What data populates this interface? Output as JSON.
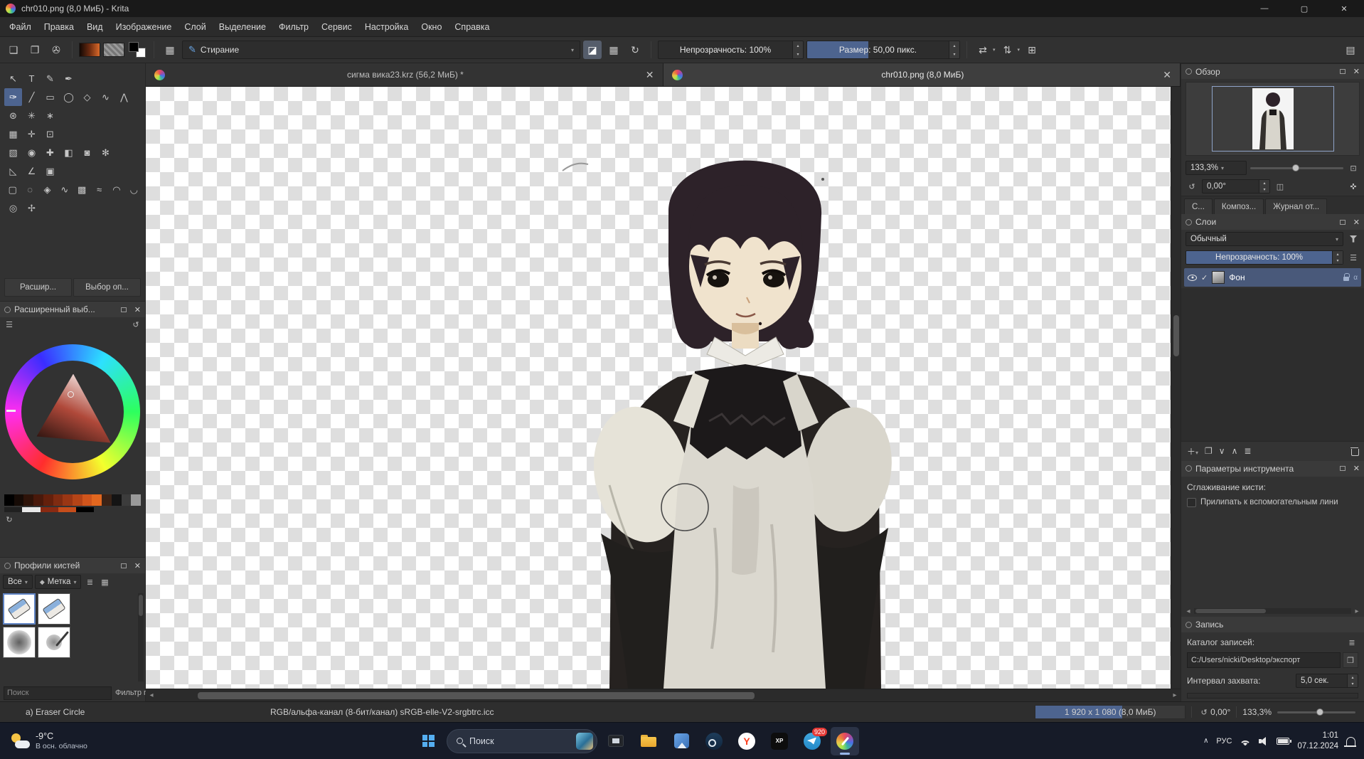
{
  "colors": {
    "accent_blue": "#4d648f",
    "selected_row": "#49597a",
    "panel_bg": "#323232",
    "taskbar_bg": "#161b28",
    "checker_light": "#ffffff",
    "checker_dark": "#dedede"
  },
  "window": {
    "title": "chr010.png (8,0 МиБ)  - Krita",
    "minimize": "—",
    "maximize": "▢",
    "close": "✕"
  },
  "menubar": {
    "items": [
      "Файл",
      "Правка",
      "Вид",
      "Изображение",
      "Слой",
      "Выделение",
      "Фильтр",
      "Сервис",
      "Настройка",
      "Окно",
      "Справка"
    ]
  },
  "toolbar": {
    "preset_name": "Стирание",
    "opacity": "Непрозрачность: 100%",
    "size": "Размер: 50,00 пикс."
  },
  "toolbox": {
    "rows": [
      [
        {
          "n": "select-shapes",
          "g": "↖"
        },
        {
          "n": "text",
          "g": "T"
        },
        {
          "n": "edit-shapes",
          "g": "✎"
        },
        {
          "n": "calligraphy",
          "g": "✒"
        }
      ],
      [
        {
          "n": "freehand-brush",
          "g": "✑",
          "active": true
        },
        {
          "n": "line",
          "g": "╱"
        },
        {
          "n": "rectangle",
          "g": "▭"
        },
        {
          "n": "ellipse",
          "g": "◯"
        },
        {
          "n": "polygon",
          "g": "◇"
        },
        {
          "n": "polyline",
          "g": "∿"
        },
        {
          "n": "freehand-path",
          "g": "⋀"
        }
      ],
      [
        {
          "n": "dynamic-brush",
          "g": "⊛"
        },
        {
          "n": "multibrush",
          "g": "✳"
        },
        {
          "n": "pattern-edit",
          "g": "∗"
        }
      ],
      [
        {
          "n": "transform",
          "g": "▦"
        },
        {
          "n": "move",
          "g": "✛"
        },
        {
          "n": "crop",
          "g": "⊡"
        }
      ],
      [
        {
          "n": "gradient",
          "g": "▧"
        },
        {
          "n": "color-sampler",
          "g": "◉"
        },
        {
          "n": "smart-patch",
          "g": "✚"
        },
        {
          "n": "fill",
          "g": "◧"
        },
        {
          "n": "enclose-fill",
          "g": "◙"
        },
        {
          "n": "colorize-mask",
          "g": "✻"
        }
      ],
      [
        {
          "n": "assistants",
          "g": "◺"
        },
        {
          "n": "measure",
          "g": "∠"
        },
        {
          "n": "reference-images",
          "g": "▣"
        }
      ],
      [
        {
          "n": "rect-select",
          "g": "▢"
        },
        {
          "n": "ellipse-select",
          "g": "◌"
        },
        {
          "n": "polygon-select",
          "g": "◈"
        },
        {
          "n": "freehand-select",
          "g": "∿"
        },
        {
          "n": "contiguous-select",
          "g": "▩"
        },
        {
          "n": "similar-select",
          "g": "≈"
        },
        {
          "n": "bezier-select",
          "g": "◠"
        },
        {
          "n": "magnetic-select",
          "g": "◡"
        }
      ],
      [
        {
          "n": "zoom",
          "g": "◎"
        },
        {
          "n": "pan",
          "g": "✢"
        }
      ]
    ]
  },
  "left": {
    "expander_tabs": [
      "Расшир...",
      "Выбор оп..."
    ],
    "selector_title": "Расширенный выб...",
    "history_row1": [
      "#000000",
      "#160b06",
      "#2e1309",
      "#49190b",
      "#64200c",
      "#7f2b11",
      "#9a3614",
      "#b54417",
      "#d0551c",
      "#e2671f",
      "#3a2317",
      "#141414",
      "#3c3c3c",
      "#9a9a9a"
    ],
    "history_row2": [
      "#202020",
      "#e8e8e8",
      "#8a2a12",
      "#c64d1b",
      "#000000"
    ],
    "presets_title": "Профили кистей",
    "filter_all": "Все",
    "tag_label": "Метка",
    "presets": [
      {
        "name": "Eraser Circle",
        "kind": "eraser",
        "selected": true
      },
      {
        "name": "Eraser Small",
        "kind": "eraser",
        "selected": false
      },
      {
        "name": "Soft Round",
        "kind": "soft",
        "selected": false
      },
      {
        "name": "Airbrush",
        "kind": "air",
        "selected": false
      }
    ],
    "search_placeholder": "Поиск",
    "tag_filter_label": "Фильтр по метке"
  },
  "tabs": [
    {
      "title": "сигма вика23.krz (56,2 МиБ) *",
      "active": false
    },
    {
      "title": "chr010.png (8,0 МиБ)",
      "active": true
    }
  ],
  "right": {
    "overview": {
      "title": "Обзор",
      "zoom": "133,3%",
      "rotation": "0,00°"
    },
    "docker_tabs": [
      "С...",
      "Композ...",
      "Журнал от..."
    ],
    "layers": {
      "title": "Слои",
      "blend_mode": "Обычный",
      "opacity": "Непрозрачность: 100%",
      "items": [
        {
          "name": "Фон"
        }
      ]
    },
    "tool_options": {
      "title": "Параметры инструмента",
      "smoothing_label": "Сглаживание кисти:",
      "snap_label": "Прилипать к вспомогательным лини"
    },
    "recorder": {
      "title": "Запись",
      "dir_label": "Каталог записей:",
      "path": "C:/Users/nicki/Desktop/экспорт",
      "interval_label": "Интервал захвата:",
      "interval_value": "5,0 сек."
    }
  },
  "statusbar": {
    "tool": "a) Eraser Circle",
    "colorspace": "RGB/альфа-канал (8-бит/канал)  sRGB-elle-V2-srgbtrc.icc",
    "dimensions": "1 920 x 1 080 (8,0 МиБ)",
    "rotation": "0,00°",
    "zoom": "133,3%"
  },
  "taskbar": {
    "weather_temp": "-9°C",
    "weather_desc": "В осн. облачно",
    "search_label": "Поиск",
    "apps": [
      {
        "name": "movies-app",
        "kind": "movies"
      },
      {
        "name": "file-explorer",
        "kind": "folder"
      },
      {
        "name": "gallery-app",
        "kind": "gallery"
      },
      {
        "name": "steam",
        "kind": "steam"
      },
      {
        "name": "yandex-browser",
        "kind": "yandex",
        "letter": "Y"
      },
      {
        "name": "xppen",
        "kind": "xppen",
        "letter": "XP"
      },
      {
        "name": "telegram",
        "kind": "telegram",
        "badge": "920"
      },
      {
        "name": "krita",
        "kind": "krita",
        "active": true
      }
    ],
    "lang": "РУС",
    "time": "1:01",
    "date": "07.12.2024"
  }
}
